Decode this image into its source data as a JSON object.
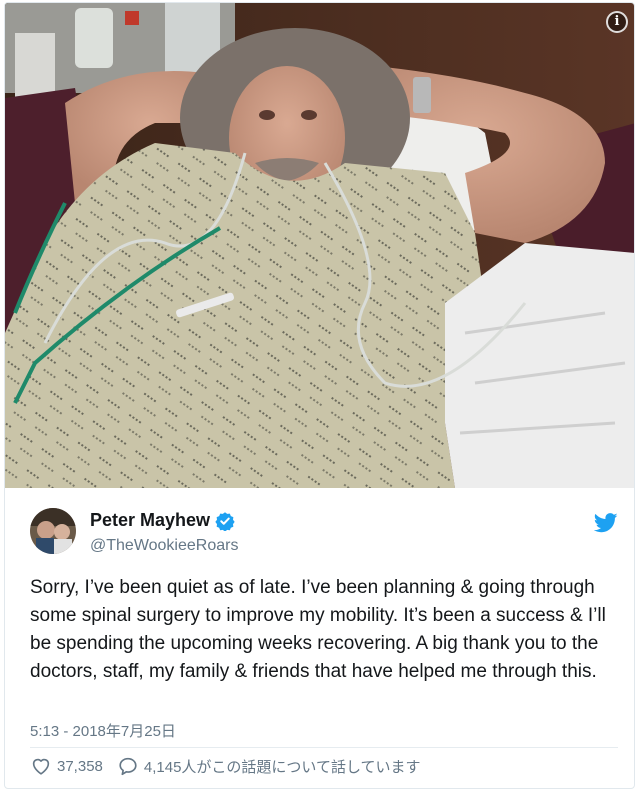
{
  "media": {
    "info_icon": "info-icon",
    "info_glyph": "i"
  },
  "user": {
    "display_name": "Peter Mayhew",
    "handle": "@TheWookieeRoars",
    "verified_icon": "verified-badge-icon"
  },
  "brand": {
    "icon": "twitter-bird-icon",
    "color": "#1da1f2"
  },
  "tweet": {
    "text": "Sorry, I’ve been quiet as of late. I’ve been planning & going through some spinal surgery to improve my mobility. It’s been a success & I’ll be spending the upcoming weeks recovering.  A big thank you to the doctors, staff, my family & friends that have helped me through this.",
    "timestamp": "5:13 - 2018年7月25日"
  },
  "actions": {
    "likes_count": "37,358",
    "likes_icon": "heart-icon",
    "talking_text": "4,145人がこの話題について話しています",
    "talking_icon": "speech-bubble-icon"
  },
  "colors": {
    "text": "#14171a",
    "secondary": "#657786",
    "divider": "#e6ecf0"
  }
}
